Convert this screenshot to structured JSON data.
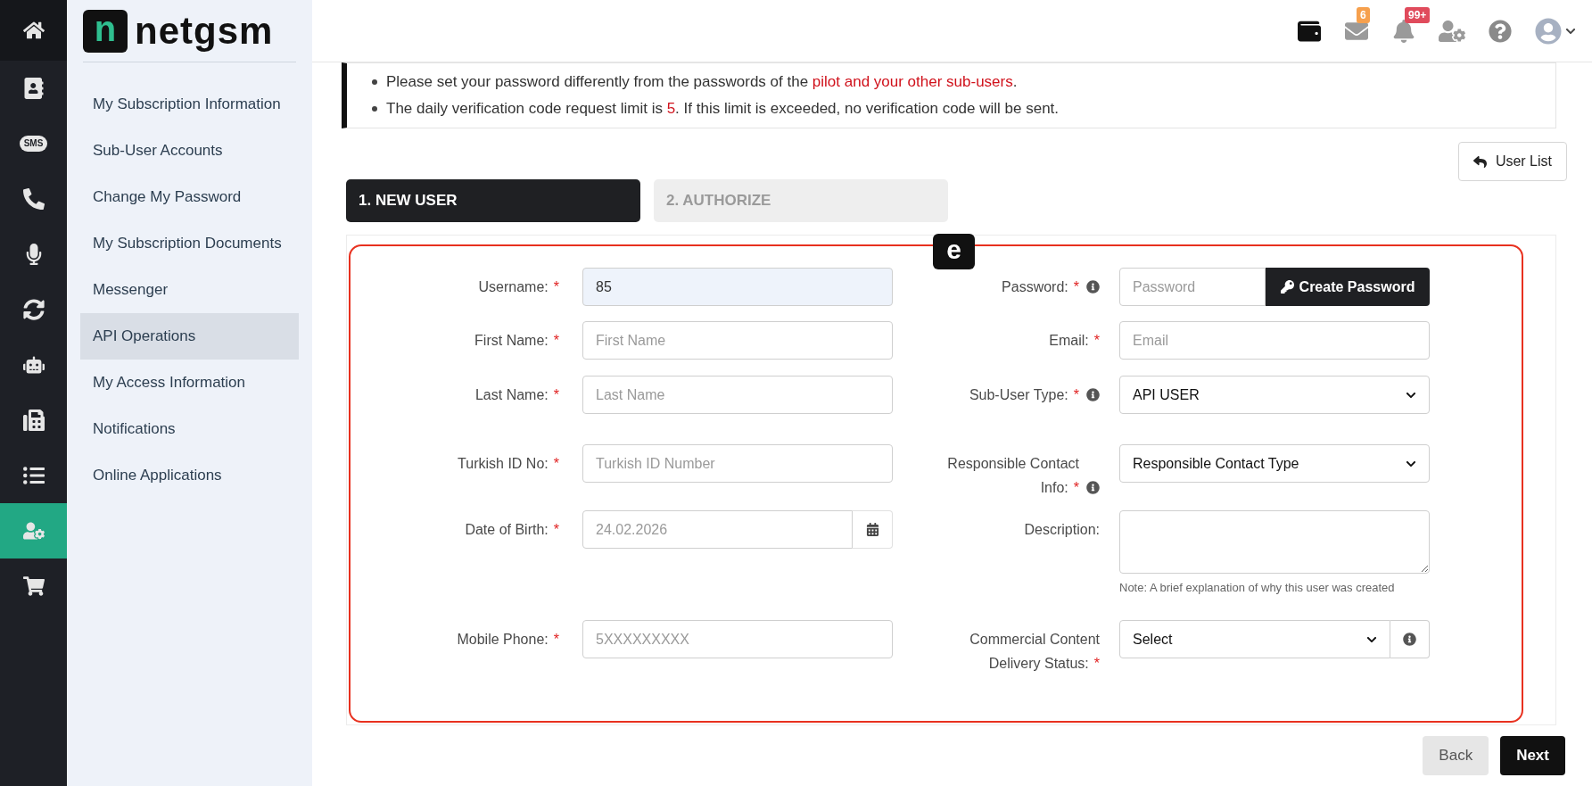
{
  "rail": [
    {
      "selected": false
    },
    {
      "selected": false
    },
    {
      "label": "SMS",
      "selected": false
    },
    {
      "selected": false
    },
    {
      "selected": false
    },
    {
      "selected": false
    },
    {
      "selected": false
    },
    {
      "selected": false
    },
    {
      "selected": false
    },
    {
      "selected": true
    },
    {
      "selected": false
    }
  ],
  "logo": {
    "mark": "n",
    "text": "netgsm"
  },
  "sidebar": {
    "items": [
      {
        "label": "My Subscription Information",
        "selected": false
      },
      {
        "label": "Sub-User Accounts",
        "selected": false
      },
      {
        "label": "Change My Password",
        "selected": false
      },
      {
        "label": "My Subscription Documents",
        "selected": false
      },
      {
        "label": "Messenger",
        "selected": false
      },
      {
        "label": "API Operations",
        "selected": true
      },
      {
        "label": "My Access Information",
        "selected": false
      },
      {
        "label": "Notifications",
        "selected": false
      },
      {
        "label": "Online Applications",
        "selected": false
      }
    ]
  },
  "topbar": {
    "mail_badge": "6",
    "bell_badge": "99+"
  },
  "notice": [
    [
      {
        "text": "Please set your password differently from the passwords of the ",
        "highlight": false
      },
      {
        "text": "pilot and your other sub-users",
        "highlight": true
      },
      {
        "text": ".",
        "highlight": false
      }
    ],
    [
      {
        "text": "The daily verification code request limit is ",
        "highlight": false
      },
      {
        "text": "5",
        "highlight": true
      },
      {
        "text": ". If this limit is exceeded, no verification code will be sent.",
        "highlight": false
      }
    ]
  ],
  "user_list_button": "User List",
  "steps": [
    {
      "label": "1. NEW USER",
      "selected": true
    },
    {
      "label": "2. AUTHORIZE",
      "selected": false
    }
  ],
  "marker": "e",
  "rows": [
    {
      "left": {
        "label": "Username:",
        "required_mark": "*",
        "kind": "text",
        "value": "85"
      },
      "right": {
        "label": "Password:",
        "required_mark": "*",
        "info": true,
        "kind": "password",
        "placeholder": "Password",
        "button": "Create Password"
      }
    },
    {
      "left": {
        "label": "First Name:",
        "required_mark": "*",
        "kind": "text",
        "placeholder": "First Name"
      },
      "right": {
        "label": "Email:",
        "required_mark": "*",
        "kind": "text",
        "placeholder": "Email"
      }
    },
    {
      "left": {
        "label": "Last Name:",
        "required_mark": "*",
        "kind": "text",
        "placeholder": "Last Name"
      },
      "right": {
        "label": "Sub-User Type:",
        "required_mark": "*",
        "info": true,
        "kind": "select",
        "value": "API USER"
      }
    },
    {
      "left": {
        "label": "Turkish ID No:",
        "required_mark": "*",
        "kind": "text",
        "placeholder": "Turkish ID Number"
      },
      "right": {
        "label": "Responsible Contact Info:",
        "required_mark": "*",
        "info": true,
        "kind": "select",
        "value": "Responsible Contact Type"
      }
    },
    {
      "left": {
        "label": "Date of Birth:",
        "required_mark": "*",
        "kind": "date",
        "placeholder": "24.02.2026"
      },
      "right": {
        "label": "Description:",
        "kind": "textarea",
        "note": "Note: A brief explanation of why this user was created"
      }
    },
    {
      "left": {
        "label": "Mobile Phone:",
        "required_mark": "*",
        "kind": "text",
        "placeholder": "5XXXXXXXXX"
      },
      "right": {
        "label": "Commercial Content Delivery Status:",
        "required_mark": "*",
        "kind": "select-info",
        "value": "Select"
      }
    }
  ],
  "footer_buttons": [
    {
      "label": "Back",
      "kind": "secondary"
    },
    {
      "label": "Next",
      "kind": "primary"
    }
  ]
}
